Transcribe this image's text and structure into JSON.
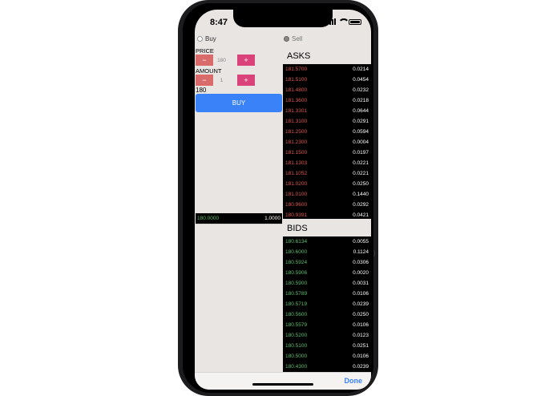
{
  "status": {
    "time": "8:47"
  },
  "segment": {
    "buy_label": "Buy",
    "sell_label": "Sell"
  },
  "form": {
    "price_label": "PRICE",
    "price_value": "180",
    "amount_label": "AMOUNT",
    "amount_value": "1",
    "minus": "−",
    "plus": "+",
    "total": "180",
    "buy_button": "BUY"
  },
  "last_trade": {
    "price": "180.0000",
    "amount": "1.0000"
  },
  "asks": {
    "title": "ASKS",
    "rows": [
      {
        "price": "181.5700",
        "amount": "0.0214"
      },
      {
        "price": "181.5100",
        "amount": "0.0454"
      },
      {
        "price": "181.4800",
        "amount": "0.0232"
      },
      {
        "price": "181.3600",
        "amount": "0.0218"
      },
      {
        "price": "181.3301",
        "amount": "0.0644"
      },
      {
        "price": "181.3100",
        "amount": "0.0291"
      },
      {
        "price": "181.2500",
        "amount": "0.0594"
      },
      {
        "price": "181.2300",
        "amount": "0.0004"
      },
      {
        "price": "181.1500",
        "amount": "0.0197"
      },
      {
        "price": "181.1303",
        "amount": "0.0221"
      },
      {
        "price": "181.1052",
        "amount": "0.0221"
      },
      {
        "price": "181.0200",
        "amount": "0.0250"
      },
      {
        "price": "181.0100",
        "amount": "0.1440"
      },
      {
        "price": "180.9600",
        "amount": "0.0292"
      },
      {
        "price": "180.9391",
        "amount": "0.0421"
      }
    ]
  },
  "bids": {
    "title": "BIDS",
    "rows": [
      {
        "price": "180.6134",
        "amount": "0.0055"
      },
      {
        "price": "180.6000",
        "amount": "0.1124"
      },
      {
        "price": "180.5924",
        "amount": "0.0306"
      },
      {
        "price": "180.5906",
        "amount": "0.0020"
      },
      {
        "price": "180.5900",
        "amount": "0.0031"
      },
      {
        "price": "180.5789",
        "amount": "0.0106"
      },
      {
        "price": "180.5719",
        "amount": "0.0239"
      },
      {
        "price": "180.5600",
        "amount": "0.0250"
      },
      {
        "price": "180.5579",
        "amount": "0.0106"
      },
      {
        "price": "180.5200",
        "amount": "0.0123"
      },
      {
        "price": "180.5100",
        "amount": "0.0251"
      },
      {
        "price": "180.5000",
        "amount": "0.0106"
      },
      {
        "price": "180.4300",
        "amount": "0.0239"
      }
    ]
  },
  "toolbar": {
    "done_label": "Done"
  },
  "side_glyph": "}"
}
